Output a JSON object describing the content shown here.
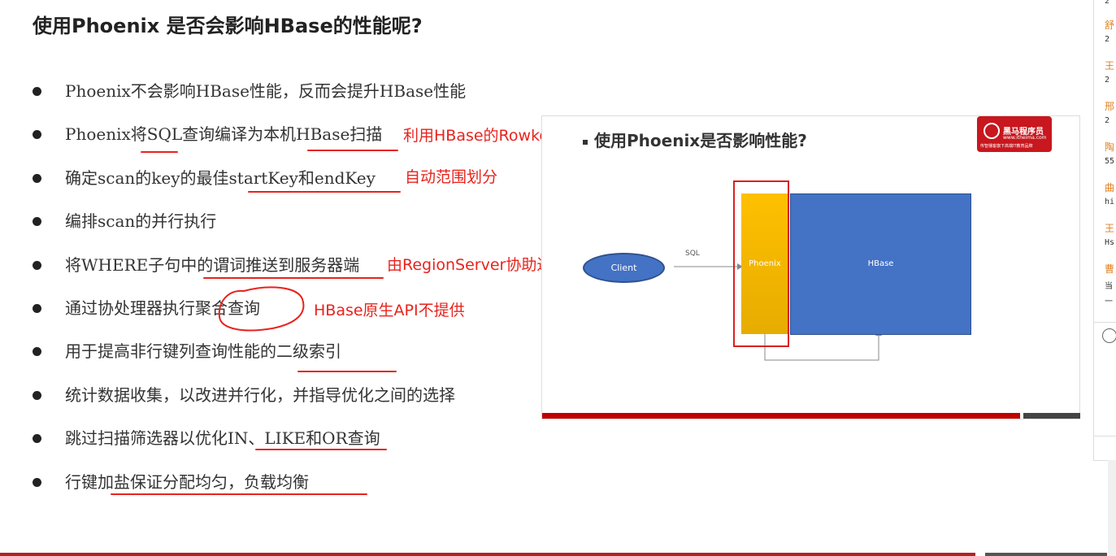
{
  "title": "使用Phoenix 是否会影响HBase的性能呢?",
  "bullets": [
    "Phoenix不会影响HBase性能，反而会提升HBase性能",
    "Phoenix将SQL查询编译为本机HBase扫描",
    "确定scan的key的最佳startKey和endKey",
    "编排scan的并行执行",
    "将WHERE子句中的谓词推送到服务器端",
    "通过协处理器执行聚合查询",
    "用于提高非行键列查询性能的二级索引",
    "统计数据收集，以改进并行化，并指导优化之间的选择",
    "跳过扫描筛选器以优化IN、LIKE和OR查询",
    "行键加盐保证分配均匀，负载均衡"
  ],
  "annotations": {
    "rowkey": "利用HBase的Rowkey能力",
    "range": "自动范围划分",
    "regionserver": "由RegionServer协助过滤",
    "api": "HBase原生API不提供"
  },
  "slide": {
    "title": "使用Phoenix是否影响性能?",
    "client": "Client",
    "sql": "SQL",
    "phoenix": "Phoenix",
    "hbase": "HBase",
    "logo_name": "黑马程序员",
    "logo_url": "www.itheima.com",
    "logo_tag": "传智播客旗下高端IT教育品牌"
  },
  "right_panel": [
    {
      "name": "",
      "value": "2"
    },
    {
      "name": "舒",
      "value": "2"
    },
    {
      "name": "王",
      "value": "2"
    },
    {
      "name": "邢",
      "value": "2"
    },
    {
      "name": "陶",
      "value": "55"
    },
    {
      "name": "曲",
      "value": "hi"
    },
    {
      "name": "王",
      "value": "Hs"
    },
    {
      "name": "曹",
      "value": "当"
    },
    {
      "name": "",
      "value": "一"
    }
  ],
  "colors": {
    "annotation": "#e8231c",
    "brand": "#c8171e",
    "phoenix": "#ffc000",
    "hbase": "#4472c4"
  }
}
